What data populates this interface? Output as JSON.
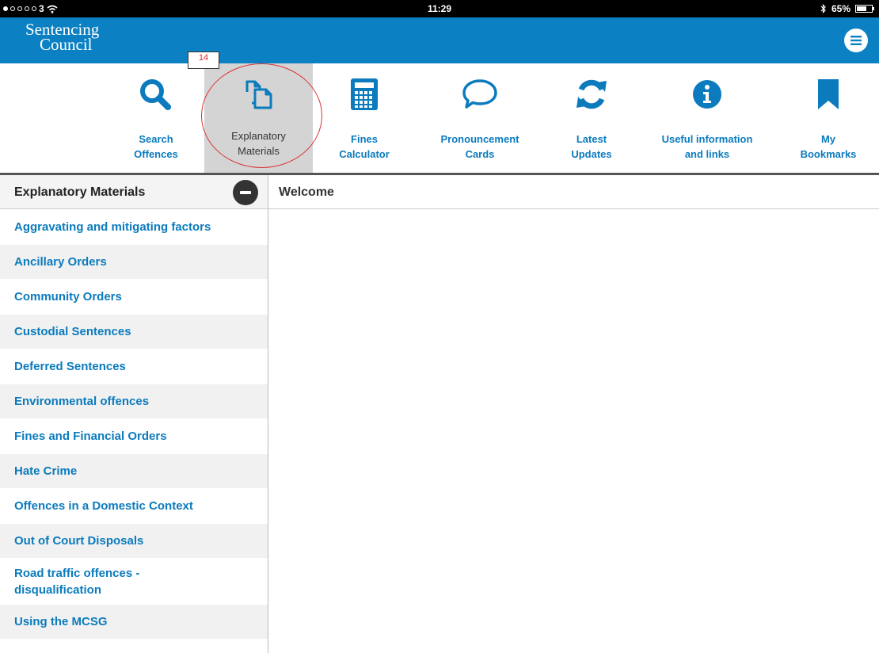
{
  "status_bar": {
    "carrier": "3",
    "time": "11:29",
    "battery": "65%"
  },
  "header": {
    "logo_line1": "Sentencing",
    "logo_line2": "Council",
    "accent_color": "#0b80c2"
  },
  "toolbar": {
    "badge": "14",
    "items": [
      {
        "line1": "Search",
        "line2": "Offences",
        "icon": "search-icon"
      },
      {
        "line1": "Explanatory",
        "line2": "Materials",
        "icon": "documents-icon",
        "active": true
      },
      {
        "line1": "Fines",
        "line2": "Calculator",
        "icon": "calculator-icon"
      },
      {
        "line1": "Pronouncement",
        "line2": "Cards",
        "icon": "speech-bubble-icon"
      },
      {
        "line1": "Latest",
        "line2": "Updates",
        "icon": "refresh-icon"
      },
      {
        "line1": "Useful information",
        "line2": "and links",
        "icon": "info-icon"
      },
      {
        "line1": "My",
        "line2": "Bookmarks",
        "icon": "bookmark-icon"
      }
    ]
  },
  "sidebar": {
    "title": "Explanatory Materials",
    "items": [
      "Aggravating and mitigating factors",
      "Ancillary Orders",
      "Community Orders",
      "Custodial Sentences",
      "Deferred Sentences",
      "Environmental offences",
      "Fines and Financial Orders",
      "Hate Crime",
      "Offences in a Domestic Context",
      "Out of Court Disposals",
      "Road traffic offences - disqualification",
      "Using the MCSG"
    ]
  },
  "main": {
    "title": "Welcome"
  }
}
